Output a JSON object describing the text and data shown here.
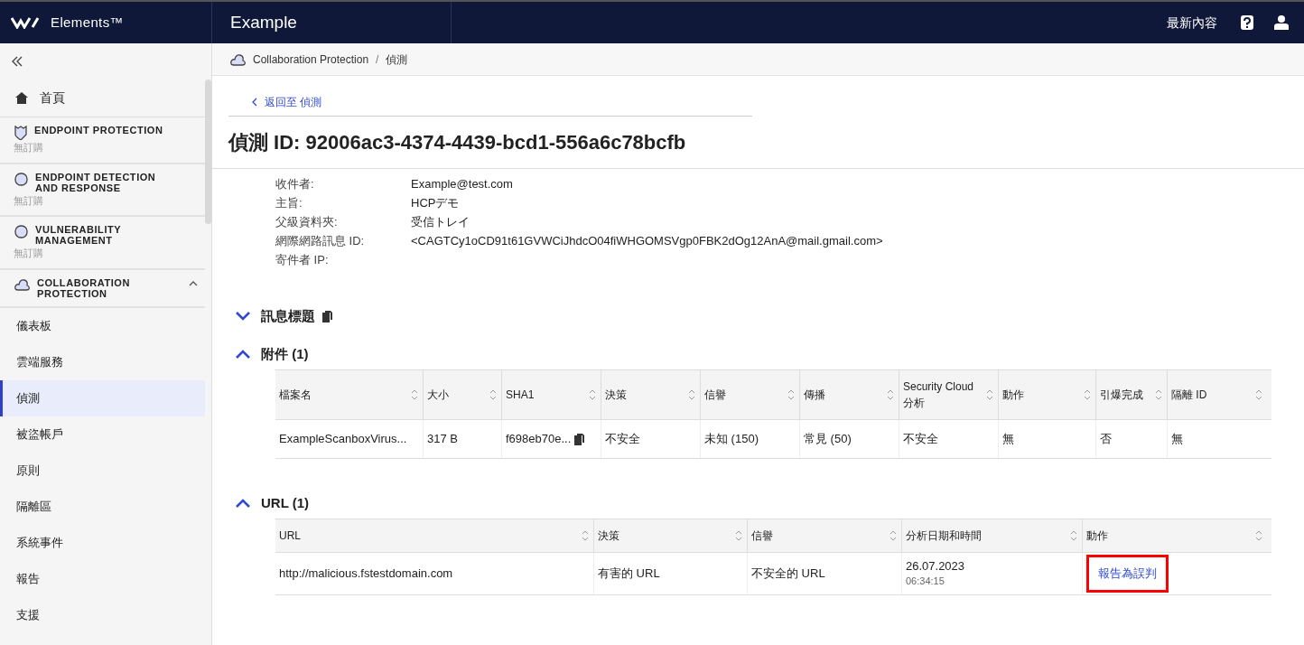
{
  "header": {
    "brand": "Elements™",
    "title": "Example",
    "whats_new": "最新內容"
  },
  "sidebar": {
    "home": "首頁",
    "products": [
      {
        "title": "ENDPOINT PROTECTION",
        "subtitle": "無訂購"
      },
      {
        "title": "ENDPOINT DETECTION AND RESPONSE",
        "subtitle": "無訂購"
      },
      {
        "title": "VULNERABILITY MANAGEMENT",
        "subtitle": "無訂購"
      },
      {
        "title": "COLLABORATION PROTECTION",
        "expanded": true
      }
    ],
    "items": [
      {
        "label": "儀表板",
        "selected": false
      },
      {
        "label": "雲端服務",
        "selected": false
      },
      {
        "label": "偵測",
        "selected": true
      },
      {
        "label": "被盜帳戶",
        "selected": false
      },
      {
        "label": "原則",
        "selected": false
      },
      {
        "label": "隔離區",
        "selected": false
      },
      {
        "label": "系統事件",
        "selected": false
      },
      {
        "label": "報告",
        "selected": false
      },
      {
        "label": "支援",
        "selected": false
      }
    ]
  },
  "breadcrumb": [
    "Collaboration Protection",
    "偵測"
  ],
  "breadcrumb_separator": "/",
  "back_link": "返回至 偵測",
  "title": "偵測 ID: 92006ac3-4374-4439-bcd1-556a6c78bcfb",
  "details": [
    {
      "label": "收件者:",
      "value": "Example@test.com"
    },
    {
      "label": "主旨:",
      "value": "HCPデモ"
    },
    {
      "label": "父級資料夾:",
      "value": "受信トレイ"
    },
    {
      "label": "網際網路訊息 ID:",
      "value": "<CAGTCy1oCD91t61GVWCiJhdcO04fiWHGOMSVgp0FBK2dOg12AnA@mail.gmail.com>"
    },
    {
      "label": "寄件者 IP:"
    }
  ],
  "sections": [
    {
      "title": "訊息標題",
      "expanded": false,
      "copy": true
    },
    {
      "title": "附件 (1)",
      "expanded": true,
      "table": {
        "columns": [
          "檔案名",
          "大小",
          "SHA1",
          "決策",
          "信譽",
          "傳播",
          "Security Cloud 分析",
          "動作",
          "引爆完成",
          "隔離 ID"
        ],
        "rows": [
          [
            {
              "text": "ExampleScanboxVirus..."
            },
            {
              "text": "317 B"
            },
            {
              "text": "f698eb70e...",
              "copy": true
            },
            {
              "text": "不安全"
            },
            {
              "text": "未知 (150)"
            },
            {
              "text": "常見 (50)"
            },
            {
              "text": "不安全"
            },
            {
              "text": "無"
            },
            {
              "text": "否"
            },
            {
              "text": "無"
            }
          ]
        ]
      }
    },
    {
      "title": "URL (1)",
      "expanded": true,
      "table": {
        "columns": [
          "URL",
          "決策",
          "信譽",
          "分析日期和時間",
          "動作"
        ],
        "rows": [
          [
            {
              "text": "http://malicious.fstestdomain.com"
            },
            {
              "text": "有害的 URL"
            },
            {
              "text": "不安全的 URL"
            },
            {
              "text": "26.07.2023",
              "subtext": "06:34:15"
            },
            {
              "text": "報告為誤判",
              "kind": "link",
              "highlighted": true
            }
          ]
        ]
      }
    }
  ]
}
